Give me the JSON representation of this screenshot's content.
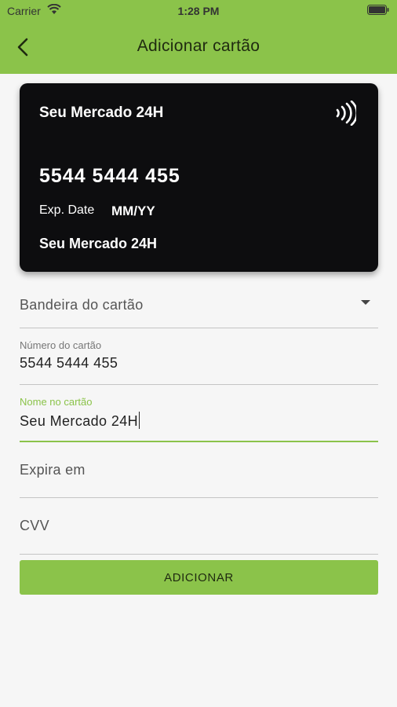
{
  "status_bar": {
    "carrier": "Carrier",
    "time": "1:28 PM"
  },
  "header": {
    "title": "Adicionar cartão",
    "back_icon": "chevron-left-icon"
  },
  "colors": {
    "accent": "#8bc34a",
    "card_bg": "#0d0d0f",
    "background": "#f6f6f6"
  },
  "card": {
    "brand": "Seu Mercado 24H",
    "number": "5544 5444 455",
    "exp_label": "Exp. Date",
    "exp_value": "MM/YY",
    "holder": "Seu Mercado 24H",
    "contactless_icon": "contactless-icon"
  },
  "form": {
    "brand_select": {
      "placeholder": "Bandeira do cartão"
    },
    "card_number": {
      "label": "Número do cartão",
      "value": "5544 5444 455"
    },
    "card_name": {
      "label": "Nome no cartão",
      "value": "Seu Mercado 24H"
    },
    "expiry": {
      "placeholder": "Expira em"
    },
    "cvv": {
      "placeholder": "CVV"
    },
    "submit_label": "ADICIONAR"
  }
}
